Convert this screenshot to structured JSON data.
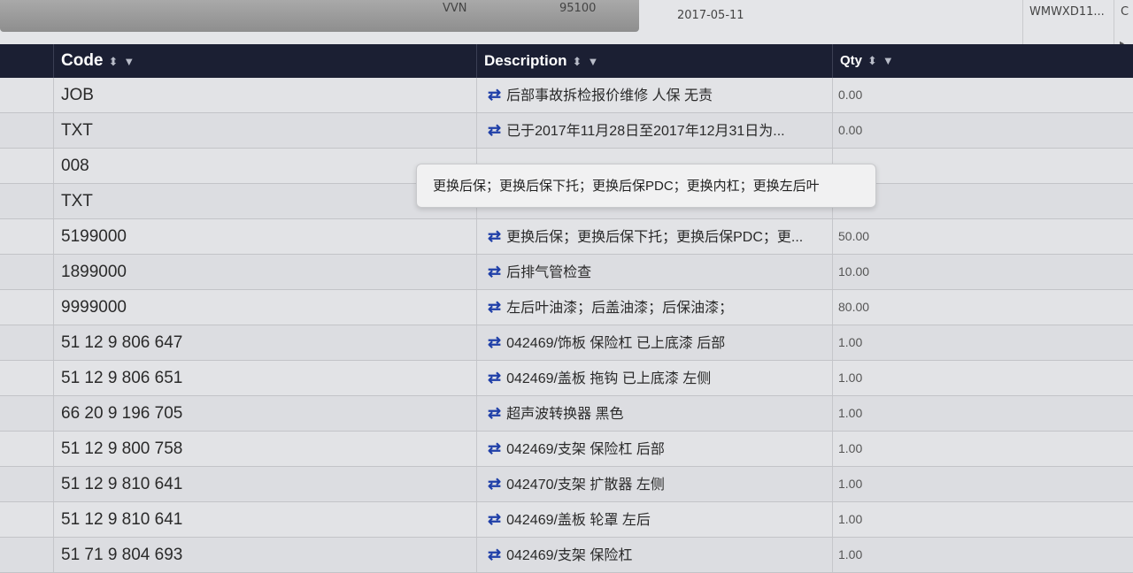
{
  "top_strip": {
    "cells": [
      "VVN",
      "95100",
      "2017-05-11",
      "WMWXD11..."
    ],
    "right_marker": "C",
    "scroll_arrow": "▸"
  },
  "grid": {
    "columns": {
      "code": "Code",
      "description": "Description",
      "qty": "Qty"
    },
    "sort_glyph": "⬍",
    "filter_glyph": "▼",
    "swap_glyph": "⇄",
    "rows": [
      {
        "code": "JOB",
        "description": "后部事故拆检报价维修 人保 无责",
        "qty": "0.00"
      },
      {
        "code": "TXT",
        "description": "已于2017年11月28日至2017年12月31日为...",
        "qty": "0.00"
      },
      {
        "code": "008",
        "description": "",
        "qty": ""
      },
      {
        "code": "TXT",
        "description": "",
        "qty": ""
      },
      {
        "code": "5199000",
        "description": "更换后保；更换后保下托；更换后保PDC；更...",
        "qty": "50.00"
      },
      {
        "code": "1899000",
        "description": "后排气管检查",
        "qty": "10.00"
      },
      {
        "code": "9999000",
        "description": "左后叶油漆；后盖油漆；后保油漆；",
        "qty": "80.00"
      },
      {
        "code": "51 12 9 806 647",
        "description": "042469/饰板 保险杠 已上底漆 后部",
        "qty": "1.00"
      },
      {
        "code": "51 12 9 806 651",
        "description": "042469/盖板 拖钩 已上底漆 左侧",
        "qty": "1.00"
      },
      {
        "code": "66 20 9 196 705",
        "description": "超声波转换器 黑色",
        "qty": "1.00"
      },
      {
        "code": "51 12 9 800 758",
        "description": "042469/支架 保险杠 后部",
        "qty": "1.00"
      },
      {
        "code": "51 12 9 810 641",
        "description": "042470/支架 扩散器 左侧",
        "qty": "1.00"
      },
      {
        "code": "51 12 9 810 641",
        "description": "042469/盖板 轮罩 左后",
        "qty": "1.00"
      },
      {
        "code": "51 71 9 804 693",
        "description": "042469/支架 保险杠",
        "qty": "1.00"
      }
    ]
  },
  "tooltip": {
    "text": "更换后保；更换后保下托；更换后保PDC；更换内杠；更换左后叶"
  }
}
